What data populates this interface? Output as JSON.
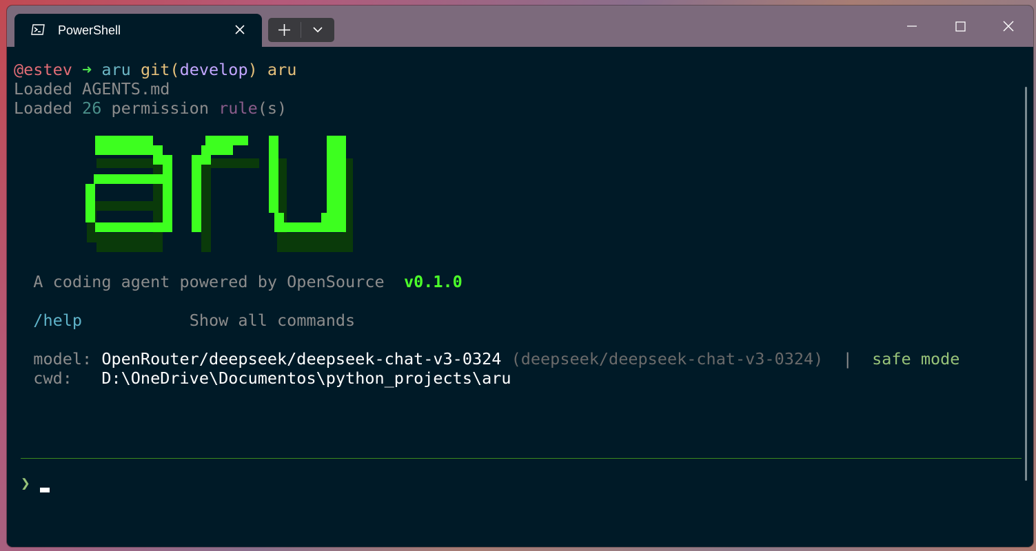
{
  "window": {
    "tab_title": "PowerShell"
  },
  "prompt_line": {
    "user": "@estev",
    "arrow": "➜",
    "dir": "aru",
    "git_label": "git(",
    "branch": "develop",
    "git_close": ")",
    "command": "aru"
  },
  "loaded_agents": {
    "prefix": "Loaded",
    "file": "AGENTS.md"
  },
  "loaded_rules": {
    "prefix": "Loaded",
    "count": "26",
    "word": "permission",
    "rule": "rule",
    "suffix": "(s)"
  },
  "banner": {
    "logo_text": "aru",
    "tagline": "A coding agent powered by OpenSource",
    "version": "v0.1.0"
  },
  "help": {
    "command": "/help",
    "description": "Show all commands"
  },
  "info": {
    "model_label": "model:",
    "model_value": "OpenRouter/deepseek/deepseek-chat-v3-0324",
    "model_alias": "(deepseek/deepseek-chat-v3-0324)",
    "pipe": "|",
    "mode": "safe mode",
    "cwd_label": "cwd:",
    "cwd_value": "D:\\OneDrive\\Documentos\\python_projects\\aru"
  },
  "input": {
    "prompt_symbol": "❯"
  },
  "colors": {
    "terminal_bg": "#001a27",
    "logo_green": "#3dff1f",
    "logo_shadow": "#0a3a0a"
  }
}
